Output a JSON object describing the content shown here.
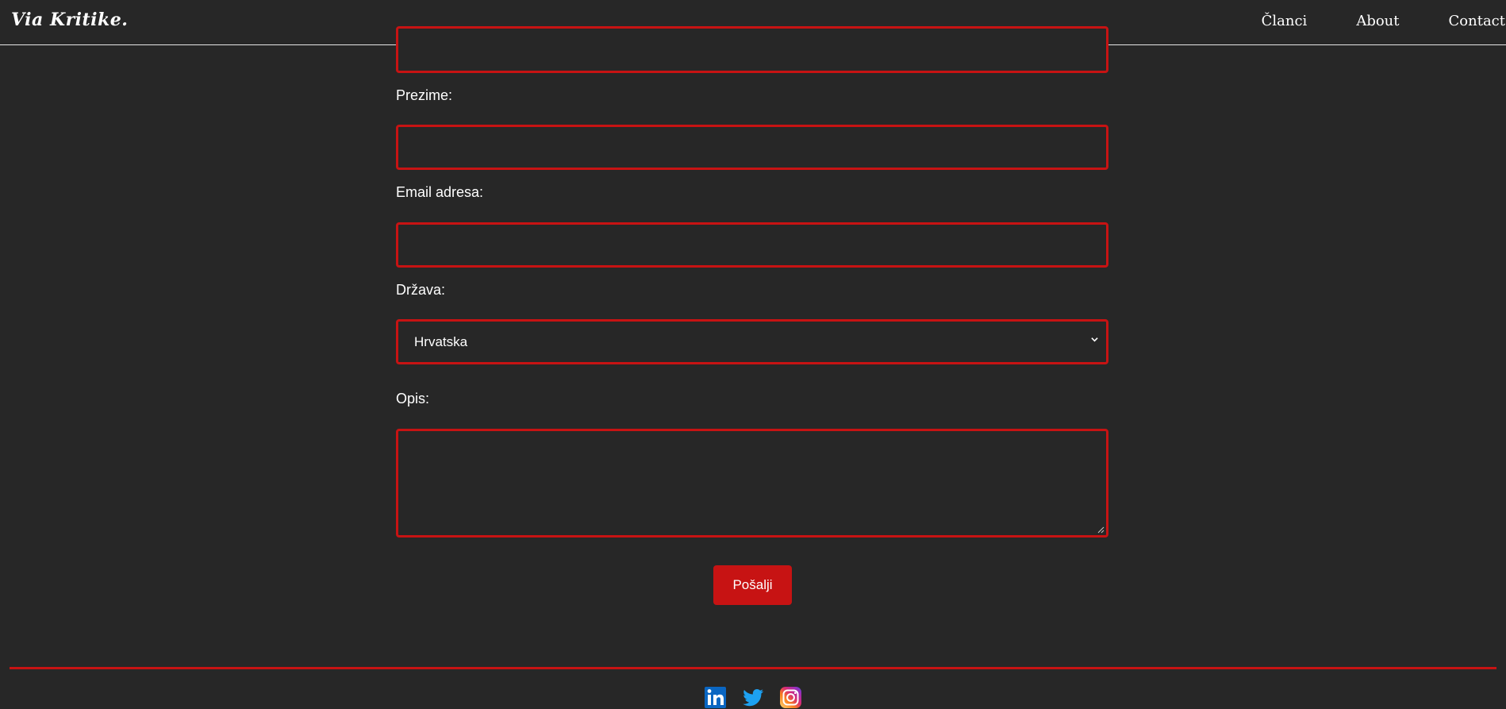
{
  "header": {
    "brand": "Via Kritike.",
    "nav": [
      {
        "label": "Članci"
      },
      {
        "label": "About"
      },
      {
        "label": "Contact"
      }
    ]
  },
  "form": {
    "prezime_label": "Prezime:",
    "email_label": "Email adresa:",
    "drzava_label": "Država:",
    "drzava_value": "Hrvatska",
    "opis_label": "Opis:",
    "submit_label": "Pošalji"
  },
  "colors": {
    "background": "#272727",
    "accent": "#c71313",
    "text": "#ffffff"
  },
  "footer": {
    "social": [
      {
        "icon": "linkedin-icon"
      },
      {
        "icon": "twitter-icon"
      },
      {
        "icon": "instagram-icon"
      }
    ]
  }
}
